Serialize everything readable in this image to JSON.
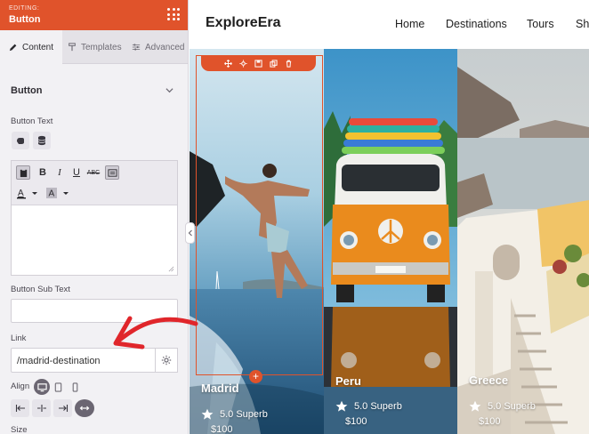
{
  "panel": {
    "editing_label": "EDITING:",
    "title": "Button",
    "tabs": [
      {
        "label": "Content",
        "icon": "pencil-icon",
        "active": true
      },
      {
        "label": "Templates",
        "icon": "paint-roller-icon",
        "active": false
      },
      {
        "label": "Advanced",
        "icon": "sliders-icon",
        "active": false
      }
    ],
    "section_title": "Button",
    "button_text_label": "Button Text",
    "button_sub_text_label": "Button Sub Text",
    "link_label": "Link",
    "link_value": "/madrid-destination",
    "align_label": "Align",
    "size_label": "Size"
  },
  "preview": {
    "brand": "ExploreEra",
    "nav": [
      "Home",
      "Destinations",
      "Tours",
      "Sh"
    ],
    "cards": [
      {
        "name": "Madrid",
        "rating": "5.0 Superb",
        "price": "$100"
      },
      {
        "name": "Peru",
        "rating": "5.0 Superb",
        "price": "$100"
      },
      {
        "name": "Greece",
        "rating": "5.0 Superb",
        "price": "$100"
      }
    ]
  },
  "colors": {
    "accent": "#e0532b",
    "panel_bg": "#f2f1f4"
  }
}
